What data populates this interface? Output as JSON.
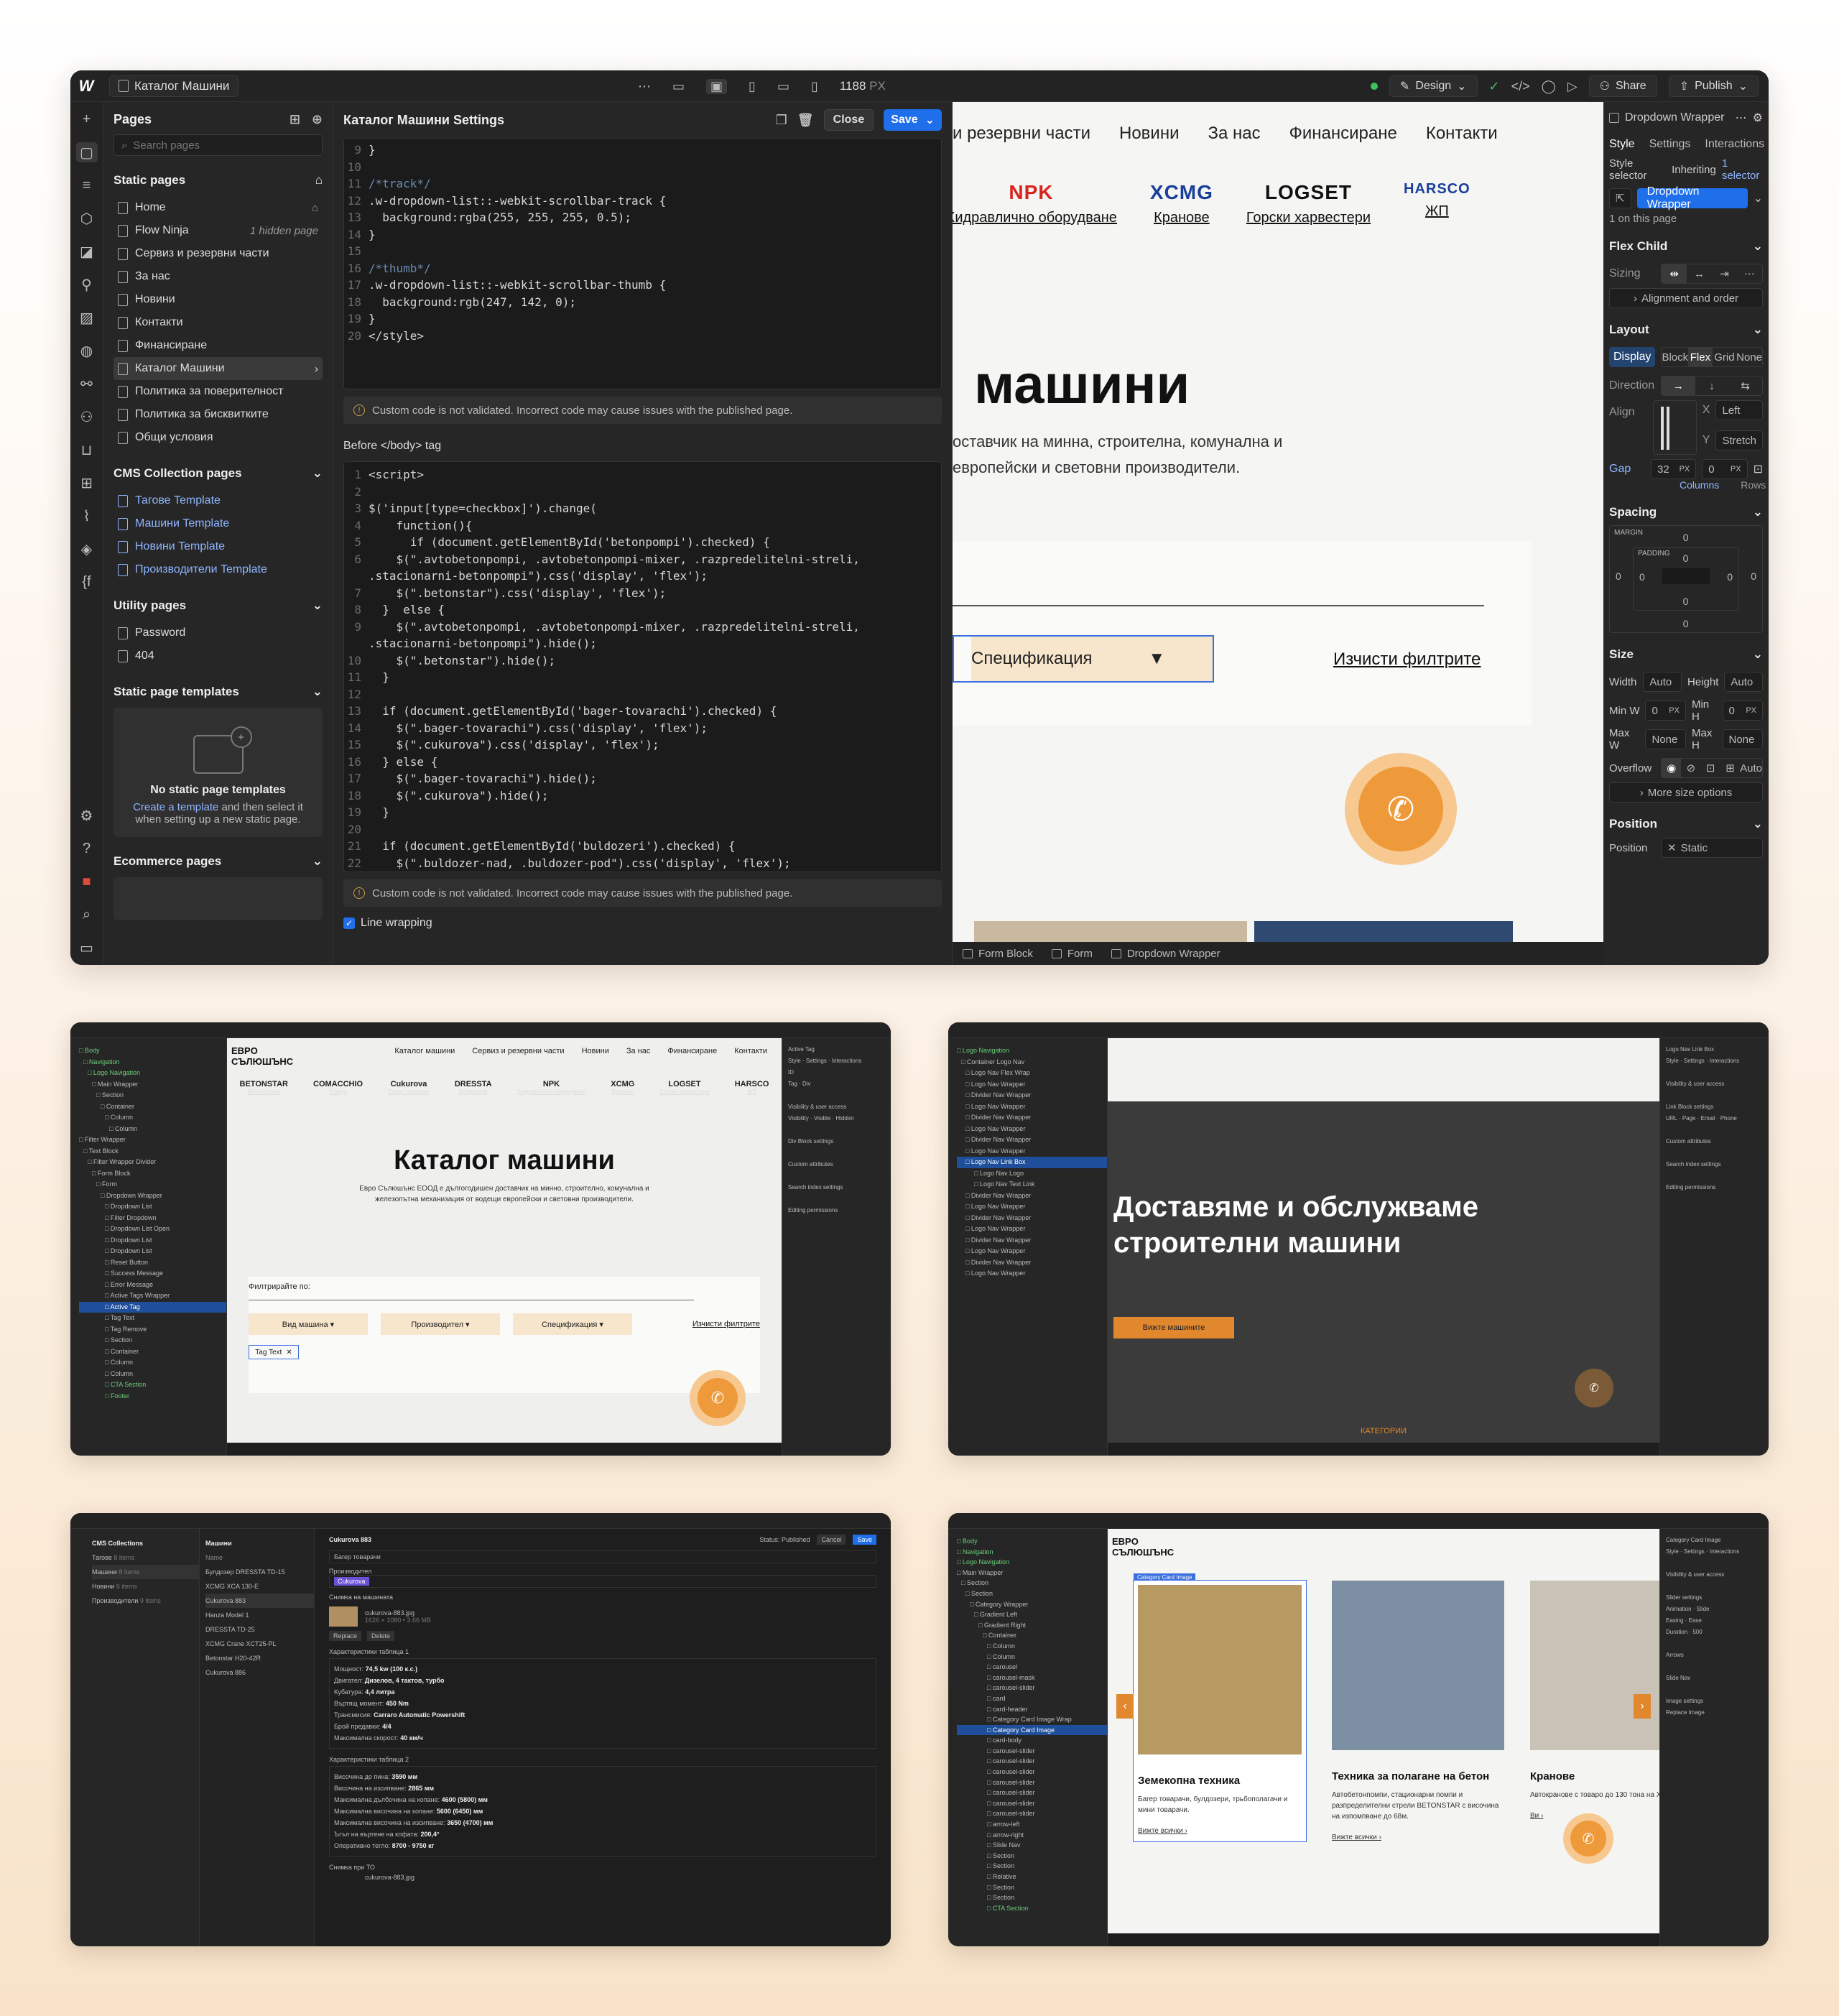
{
  "main": {
    "topbar": {
      "logo": "W",
      "page": "Каталог Машини",
      "width": "1188",
      "unit": "PX",
      "design": "Design",
      "share": "Share",
      "publish": "Publish"
    },
    "pages_panel": {
      "title": "Pages",
      "search_placeholder": "Search pages",
      "static_title": "Static pages",
      "static": [
        {
          "label": "Home",
          "note": ""
        },
        {
          "label": "Flow Ninja",
          "note": "1 hidden page"
        },
        {
          "label": "Сервиз и резервни части",
          "note": ""
        },
        {
          "label": "За нас",
          "note": ""
        },
        {
          "label": "Новини",
          "note": ""
        },
        {
          "label": "Контакти",
          "note": ""
        },
        {
          "label": "Финансиране",
          "note": ""
        },
        {
          "label": "Каталог Машини",
          "note": ""
        },
        {
          "label": "Политика за поверителност",
          "note": ""
        },
        {
          "label": "Политика за бисквитките",
          "note": ""
        },
        {
          "label": "Общи условия",
          "note": ""
        }
      ],
      "cms_title": "CMS Collection pages",
      "cms": [
        "Тагове Template",
        "Машини Template",
        "Новини Template",
        "Производители Template"
      ],
      "utility_title": "Utility pages",
      "utility": [
        "Password",
        "404"
      ],
      "templates_title": "Static page templates",
      "templates_empty_title": "No static page templates",
      "templates_link": "Create a template",
      "templates_text_a": " and then select it",
      "templates_text_b": "when setting up a new static page.",
      "ecommerce_title": "Ecommerce pages"
    },
    "settings": {
      "title": "Каталог Машини Settings",
      "close": "Close",
      "save": "Save",
      "code1": [
        {
          "n": "9",
          "t": "}"
        },
        {
          "n": "10",
          "t": ""
        },
        {
          "n": "11",
          "t": "/*track*/",
          "c": true
        },
        {
          "n": "12",
          "t": ".w-dropdown-list::-webkit-scrollbar-track {"
        },
        {
          "n": "13",
          "t": "  background:rgba(255, 255, 255, 0.5);"
        },
        {
          "n": "14",
          "t": "}"
        },
        {
          "n": "15",
          "t": ""
        },
        {
          "n": "16",
          "t": "/*thumb*/",
          "c": true
        },
        {
          "n": "17",
          "t": ".w-dropdown-list::-webkit-scrollbar-thumb {"
        },
        {
          "n": "18",
          "t": "  background:rgb(247, 142, 0);"
        },
        {
          "n": "19",
          "t": "}"
        },
        {
          "n": "20",
          "t": "</style>"
        }
      ],
      "warning": "Custom code is not validated. Incorrect code may cause issues with the published page.",
      "before_body_label": "Before </body> tag",
      "code2": [
        {
          "n": "1",
          "t": "<script>"
        },
        {
          "n": "2",
          "t": ""
        },
        {
          "n": "3",
          "t": "$('input[type=checkbox]').change("
        },
        {
          "n": "4",
          "t": "    function(){"
        },
        {
          "n": "5",
          "t": "      if (document.getElementById('betonpompi').checked) {"
        },
        {
          "n": "6",
          "t": "    $(\".avtobetonpompi, .avtobetonpompi-mixer, .razpredelitelni-streli,"
        },
        {
          "n": "",
          "t": ".stacionarni-betonpompi\").css('display', 'flex');"
        },
        {
          "n": "7",
          "t": "    $(\".betonstar\").css('display', 'flex');"
        },
        {
          "n": "8",
          "t": "  }  else {"
        },
        {
          "n": "9",
          "t": "    $(\".avtobetonpompi, .avtobetonpompi-mixer, .razpredelitelni-streli,"
        },
        {
          "n": "",
          "t": ".stacionarni-betonpompi\").hide();"
        },
        {
          "n": "10",
          "t": "    $(\".betonstar\").hide();"
        },
        {
          "n": "11",
          "t": "  }"
        },
        {
          "n": "12",
          "t": ""
        },
        {
          "n": "13",
          "t": "  if (document.getElementById('bager-tovarachi').checked) {"
        },
        {
          "n": "14",
          "t": "    $(\".bager-tovarachi\").css('display', 'flex');"
        },
        {
          "n": "15",
          "t": "    $(\".cukurova\").css('display', 'flex');"
        },
        {
          "n": "16",
          "t": "  } else {"
        },
        {
          "n": "17",
          "t": "    $(\".bager-tovarachi\").hide();"
        },
        {
          "n": "18",
          "t": "    $(\".cukurova\").hide();"
        },
        {
          "n": "19",
          "t": "  }"
        },
        {
          "n": "20",
          "t": ""
        },
        {
          "n": "21",
          "t": "  if (document.getElementById('buldozeri').checked) {"
        },
        {
          "n": "22",
          "t": "    $(\".buldozer-nad, .buldozer-pod\").css('display', 'flex');"
        }
      ],
      "line_wrapping": "Line wrapping"
    },
    "canvas": {
      "nav": [
        "и резервни части",
        "Новини",
        "За нас",
        "Финансиране",
        "Контакти"
      ],
      "brands": [
        {
          "logo": "NPK",
          "name": "Хидравлично оборудване",
          "color": "#d8241f"
        },
        {
          "logo": "XCMG",
          "name": "Кранове",
          "color": "#1a3f9a"
        },
        {
          "logo": "LOGSET",
          "name": "Горски харвестери",
          "color": "#111111"
        },
        {
          "logo": "HARSCO",
          "name": "ЖП",
          "color": "#1a3f9a"
        }
      ],
      "hero_title": "машини",
      "hero_line1": "оставчик на минна, строителна, комунална и",
      "hero_line2": "европейски и световни производители.",
      "spec_button": "Спецификация",
      "clear_filters": "Изчисти филтрите",
      "breadcrumbs": [
        "Form Block",
        "Form",
        "Dropdown Wrapper"
      ]
    },
    "style_panel": {
      "element": "Dropdown Wrapper",
      "tabs": [
        "Style",
        "Settings",
        "Interactions"
      ],
      "selector_label": "Style selector",
      "inheriting": "Inheriting",
      "inheriting_count": "1 selector",
      "selector": "Dropdown Wrapper",
      "on_page": "1 on this page",
      "flex_child": "Flex Child",
      "sizing": "Sizing",
      "align_order": "Alignment and order",
      "layout": "Layout",
      "display": "Display",
      "display_opts": [
        "Block",
        "Flex",
        "Grid",
        "None"
      ],
      "direction": "Direction",
      "align": "Align",
      "x_align": "Left",
      "y_align": "Stretch",
      "gap": "Gap",
      "gap_val": "32",
      "gap_val2": "0",
      "px": "PX",
      "columns": "Columns",
      "rows": "Rows",
      "spacing": "Spacing",
      "margin": "MARGIN",
      "padding": "PADDING",
      "zero": "0",
      "size": "Size",
      "width": "Width",
      "height": "Height",
      "auto": "Auto",
      "minw": "Min W",
      "minh": "Min H",
      "maxw": "Max W",
      "maxh": "Max H",
      "none": "None",
      "overflow": "Overflow",
      "more_size": "More size options",
      "position": "Position",
      "position_val": "Static"
    }
  },
  "thumb1": {
    "nav": [
      "Каталог машини",
      "Сервиз и резервни части",
      "Новини",
      "За нас",
      "Финансиране",
      "Контакти"
    ],
    "brands": [
      "BETONSTAR",
      "COMACCHIO",
      "Cukurova",
      "DRESSTA",
      "NPK",
      "XCMG",
      "LOGSET",
      "HARSCO"
    ],
    "brand_names": [
      "Бетонпомпи",
      "Сонди",
      "Багер товарачи",
      "Булдозери",
      "Хидравлично оборудване",
      "Кранове",
      "Горски харвестери",
      "ЖП"
    ],
    "title": "Каталог машини",
    "sub": "Евро Сълюшънс ЕООД е дългогодишен доставчик на минно, строително, комунална и железопътна механизация от водещи европейски и световни производители.",
    "filter_label": "Филтрирайте по:",
    "filters": [
      "Вид машина",
      "Производител",
      "Спецификация"
    ],
    "clear": "Изчисти филтрите",
    "tag": "Tag Text",
    "tree": [
      "Body",
      "Navigation",
      "Logo Navigation",
      "Main Wrapper",
      "Section",
      "Container",
      "Column",
      "Column",
      "Filter Wrapper",
      "Text Block",
      "Filter Wrapper Divider",
      "Form Block",
      "Form",
      "Dropdown Wrapper",
      "Dropdown List",
      "Filter Dropdown",
      "Dropdown List Open",
      "Dropdown List",
      "Dropdown List",
      "Reset Button",
      "Success Message",
      "Error Message",
      "Active Tags Wrapper",
      "Active Tag",
      "Tag Text",
      "Tag Remove",
      "Section",
      "Container",
      "Column",
      "Column",
      "CTA Section",
      "Footer"
    ]
  },
  "thumb2": {
    "title_line1": "Доставяме и обслужваме",
    "title_line2": "строителни машини",
    "button": "Вижте машините",
    "categories": "КАТЕГОРИИ",
    "tree": [
      "Logo Navigation",
      "Container Logo Nav",
      "Logo Nav Flex Wrap",
      "Logo Nav Wrapper",
      "Divider Nav Wrapper",
      "Logo Nav Wrapper",
      "Divider Nav Wrapper",
      "Logo Nav Wrapper",
      "Divider Nav Wrapper",
      "Logo Nav Wrapper",
      "Logo Nav Link Box",
      "Logo Nav Logo",
      "Logo Nav Text Link",
      "Divider Nav Wrapper",
      "Logo Nav Wrapper",
      "Divider Nav Wrapper",
      "Logo Nav Wrapper",
      "Divider Nav Wrapper",
      "Logo Nav Wrapper",
      "Divider Nav Wrapper",
      "Logo Nav Wrapper"
    ]
  },
  "thumb3": {
    "collections_title": "CMS Collections",
    "collections": [
      {
        "name": "Тагове",
        "count": "8 items"
      },
      {
        "name": "Машини",
        "count": "8 items"
      },
      {
        "name": "Новини",
        "count": "6 items"
      },
      {
        "name": "Производители",
        "count": "9 items"
      }
    ],
    "items_title": "Машини",
    "items_head": "Name",
    "items": [
      "Булдозер DRESSTA TD-15",
      "XCMG XCA 130-E",
      "Cukurova 883",
      "Hanza Model 1",
      "DRESSTA TD-25",
      "XCMG Crane XCT25-PL",
      "Betonstar H20-42R",
      "Cukurova 886"
    ],
    "editor_title": "Cukurova 883",
    "status": "Status: Published",
    "cancel": "Cancel",
    "save": "Save",
    "field1": "Багер товарачи",
    "field2_label": "Производител",
    "field2": "Cukurova",
    "img_label": "Снимка на машината",
    "img_file": "cukurova-883.jpg",
    "img_meta": "1626 × 1080 • 3.66 MB",
    "replace": "Replace",
    "delete": "Delete",
    "t1_label": "Характеристики таблица 1",
    "t1": [
      [
        "Мощност:",
        "74,5 kw (100 к.с.)"
      ],
      [
        "Двигател:",
        "Дизелов, 4 тактов, турбо"
      ],
      [
        "Кубатура:",
        "4,4 литра"
      ],
      [
        "Въртящ момент:",
        "450 Nm"
      ],
      [
        "Трансмисия:",
        "Carraro Automatic Powershift"
      ],
      [
        "Брой предавки:",
        "4/4"
      ],
      [
        "Максимална скорост:",
        "40 км/ч"
      ]
    ],
    "t2_label": "Характеристики таблица 2",
    "t2": [
      [
        "Височина до пина:",
        "3590 мм"
      ],
      [
        "Височина на изсипване:",
        "2865 мм"
      ],
      [
        "Максимална дълбочина на копане:",
        "4600 (5800) мм"
      ],
      [
        "Максимална височина на копане:",
        "5600 (6450) мм"
      ],
      [
        "Максимална височина на изсипване:",
        "3650 (4700) мм"
      ],
      [
        "Ъгъл на въртене на кофата:",
        "200,4°"
      ],
      [
        "Оперативно тегло:",
        "8700 - 9750 кг"
      ]
    ],
    "extra_label": "Снимка при ТО",
    "extra_file": "cukurova-883.jpg"
  },
  "thumb4": {
    "cards": [
      {
        "title": "Земекопна техника",
        "text": "Багер товарачи, булдозери, трьбополагачи и мини товарачи.",
        "link": "Вижте всички"
      },
      {
        "title": "Техника за полагане на бетон",
        "text": "Автобетонпомпи, стационарни помпи и разпределителни стрели BETONSTAR с височина на изпомпване до 68м.",
        "link": "Вижте всички"
      },
      {
        "title": "Кранове",
        "text": "Автокранове с товаро до 130 тона на ХСМG.",
        "link": "Ви"
      }
    ],
    "tag": "Category Card Image",
    "tree": [
      "Body",
      "Navigation",
      "Logo Navigation",
      "Main Wrapper",
      "Section",
      "Section",
      "Category Wrapper",
      "Gradient Left",
      "Gradient Right",
      "Container",
      "Column",
      "Column",
      "carousel",
      "carousel-mask",
      "carousel-slider",
      "card",
      "card-header",
      "Category Card Image Wrap",
      "Category Card Image",
      "card-body",
      "carousel-slider",
      "carousel-slider",
      "carousel-slider",
      "carousel-slider",
      "carousel-slider",
      "carousel-slider",
      "carousel-slider",
      "arrow-left",
      "arrow-right",
      "Slide Nav",
      "Section",
      "Section",
      "Relative",
      "Section",
      "Section",
      "CTA Section"
    ]
  }
}
